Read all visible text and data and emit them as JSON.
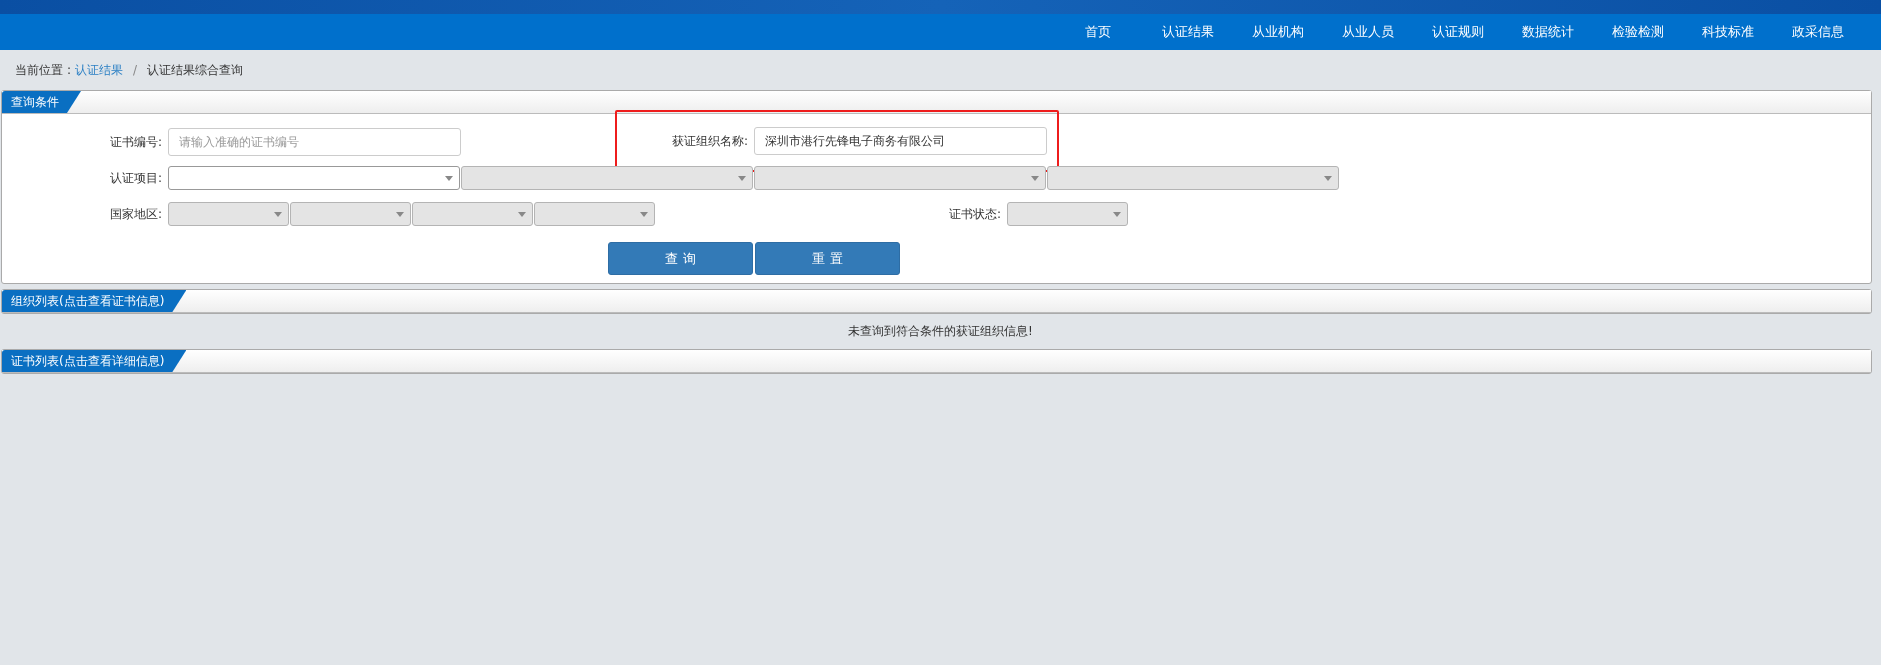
{
  "nav": {
    "items": [
      {
        "label": "首页"
      },
      {
        "label": "认证结果"
      },
      {
        "label": "从业机构"
      },
      {
        "label": "从业人员"
      },
      {
        "label": "认证规则"
      },
      {
        "label": "数据统计"
      },
      {
        "label": "检验检测"
      },
      {
        "label": "科技标准"
      },
      {
        "label": "政采信息"
      }
    ]
  },
  "breadcrumb": {
    "prefix": "当前位置",
    "colon": ":",
    "link": "认证结果",
    "separator": "/",
    "current": "认证结果综合查询"
  },
  "query_panel": {
    "title": "查询条件",
    "cert_no": {
      "label": "证书编号:",
      "placeholder": "请输入准确的证书编号"
    },
    "org_name": {
      "label": "获证组织名称:",
      "value": "深圳市港行先锋电子商务有限公司",
      "highlighted": true
    },
    "project": {
      "label": "认证项目:",
      "selects": [
        {
          "disabled": false
        },
        {
          "disabled": true
        },
        {
          "disabled": true
        },
        {
          "disabled": true
        }
      ]
    },
    "region": {
      "label": "国家地区:",
      "selects": [
        {
          "disabled": true
        },
        {
          "disabled": true
        },
        {
          "disabled": true
        },
        {
          "disabled": true
        }
      ]
    },
    "status": {
      "label": "证书状态:",
      "selects": [
        {
          "disabled": true
        }
      ]
    },
    "buttons": [
      "查 询",
      "重 置"
    ]
  },
  "org_list": {
    "title": "组织列表(点击查看证书信息)",
    "message": "未查询到符合条件的获证组织信息!"
  },
  "cert_list": {
    "title": "证书列表(点击查看详细信息)"
  }
}
